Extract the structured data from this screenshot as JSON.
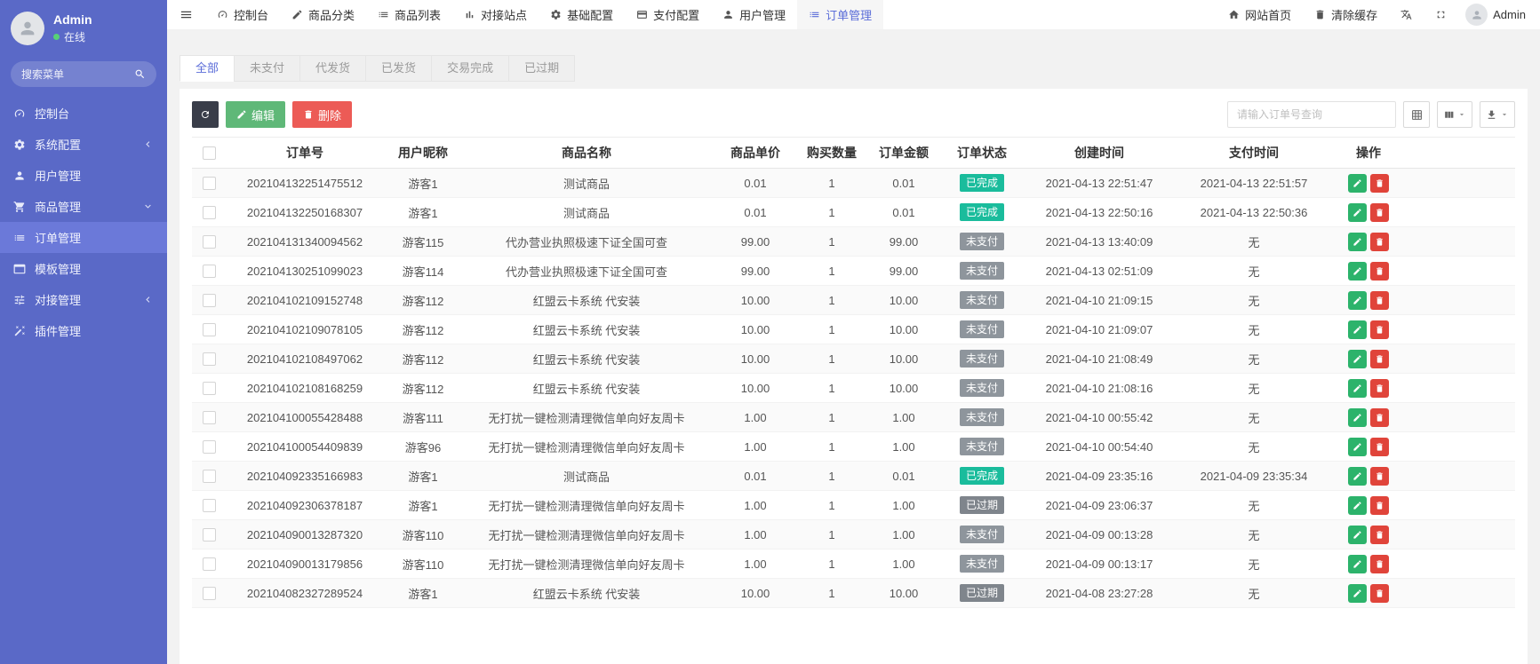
{
  "colors": {
    "sidebar_bg": "#5a69c7",
    "sidebar_active_bg": "#6b79d9",
    "topnav_active_color": "#5a6cd8",
    "online_dot": "#57d176",
    "badge_done": "#1abc9c",
    "badge_unpaid": "#8e959c",
    "badge_expired": "#7f858c",
    "btn_refresh_bg": "#393d49",
    "btn_edit_bg": "#5fb878",
    "btn_delete_bg": "#ec5b56",
    "row_edit_bg": "#2cb36b",
    "row_delete_bg": "#e0443a"
  },
  "sidebar": {
    "user": {
      "name": "Admin",
      "status": "在线"
    },
    "search_placeholder": "搜索菜单",
    "items": [
      {
        "key": "console",
        "label": "控制台",
        "icon": "dashboard-icon",
        "arrow": "",
        "active": false
      },
      {
        "key": "system-config",
        "label": "系统配置",
        "icon": "gear-icon",
        "arrow": "left",
        "active": false
      },
      {
        "key": "user-management",
        "label": "用户管理",
        "icon": "user-icon",
        "arrow": "",
        "active": false
      },
      {
        "key": "product-management",
        "label": "商品管理",
        "icon": "cart-icon",
        "arrow": "down",
        "active": false
      },
      {
        "key": "order-management",
        "label": "订单管理",
        "icon": "list-icon",
        "arrow": "",
        "active": true
      },
      {
        "key": "template-management",
        "label": "模板管理",
        "icon": "window-icon",
        "arrow": "",
        "active": false
      },
      {
        "key": "integration-management",
        "label": "对接管理",
        "icon": "sliders-icon",
        "arrow": "left",
        "active": false
      },
      {
        "key": "plugin-management",
        "label": "插件管理",
        "icon": "wand-icon",
        "arrow": "",
        "active": false
      }
    ]
  },
  "topnav": {
    "items": [
      {
        "key": "console",
        "label": "控制台",
        "icon": "dashboard-icon",
        "active": false
      },
      {
        "key": "product-category",
        "label": "商品分类",
        "icon": "edit-icon",
        "active": false
      },
      {
        "key": "product-list",
        "label": "商品列表",
        "icon": "list-icon",
        "active": false
      },
      {
        "key": "integration-sites",
        "label": "对接站点",
        "icon": "chart-icon",
        "active": false
      },
      {
        "key": "basic-config",
        "label": "基础配置",
        "icon": "gear-icon",
        "active": false
      },
      {
        "key": "payment-config",
        "label": "支付配置",
        "icon": "card-icon",
        "active": false
      },
      {
        "key": "user-management",
        "label": "用户管理",
        "icon": "user-icon",
        "active": false
      },
      {
        "key": "order-management",
        "label": "订单管理",
        "icon": "list-icon",
        "active": true
      }
    ],
    "right_items": [
      {
        "key": "site-home",
        "label": "网站首页",
        "icon": "home-icon"
      },
      {
        "key": "clear-cache",
        "label": "清除缓存",
        "icon": "trash-icon"
      },
      {
        "key": "translate",
        "label": "",
        "icon": "translate-icon"
      },
      {
        "key": "fullscreen",
        "label": "",
        "icon": "fullscreen-icon"
      }
    ],
    "user": {
      "name": "Admin"
    }
  },
  "tabs": [
    {
      "key": "all",
      "label": "全部",
      "active": true
    },
    {
      "key": "unpaid",
      "label": "未支付",
      "active": false
    },
    {
      "key": "to-ship",
      "label": "代发货",
      "active": false
    },
    {
      "key": "shipped",
      "label": "已发货",
      "active": false
    },
    {
      "key": "completed",
      "label": "交易完成",
      "active": false
    },
    {
      "key": "expired",
      "label": "已过期",
      "active": false
    }
  ],
  "toolbar": {
    "edit_label": "编辑",
    "delete_label": "删除",
    "search_placeholder": "请输入订单号查询"
  },
  "table": {
    "columns": [
      "订单号",
      "用户昵称",
      "商品名称",
      "商品单价",
      "购买数量",
      "订单金额",
      "订单状态",
      "创建时间",
      "支付时间",
      "操作"
    ],
    "rows": [
      {
        "order_no": "202104132251475512",
        "nickname": "游客1",
        "product": "测试商品",
        "price": "0.01",
        "quantity": "1",
        "amount": "0.01",
        "status": "已完成",
        "status_type": "done",
        "created": "2021-04-13 22:51:47",
        "paid": "2021-04-13 22:51:57"
      },
      {
        "order_no": "202104132250168307",
        "nickname": "游客1",
        "product": "测试商品",
        "price": "0.01",
        "quantity": "1",
        "amount": "0.01",
        "status": "已完成",
        "status_type": "done",
        "created": "2021-04-13 22:50:16",
        "paid": "2021-04-13 22:50:36"
      },
      {
        "order_no": "202104131340094562",
        "nickname": "游客115",
        "product": "代办营业执照极速下证全国可查",
        "price": "99.00",
        "quantity": "1",
        "amount": "99.00",
        "status": "未支付",
        "status_type": "unpaid",
        "created": "2021-04-13 13:40:09",
        "paid": "无"
      },
      {
        "order_no": "202104130251099023",
        "nickname": "游客114",
        "product": "代办营业执照极速下证全国可查",
        "price": "99.00",
        "quantity": "1",
        "amount": "99.00",
        "status": "未支付",
        "status_type": "unpaid",
        "created": "2021-04-13 02:51:09",
        "paid": "无"
      },
      {
        "order_no": "202104102109152748",
        "nickname": "游客112",
        "product": "红盟云卡系统 代安装",
        "price": "10.00",
        "quantity": "1",
        "amount": "10.00",
        "status": "未支付",
        "status_type": "unpaid",
        "created": "2021-04-10 21:09:15",
        "paid": "无"
      },
      {
        "order_no": "202104102109078105",
        "nickname": "游客112",
        "product": "红盟云卡系统 代安装",
        "price": "10.00",
        "quantity": "1",
        "amount": "10.00",
        "status": "未支付",
        "status_type": "unpaid",
        "created": "2021-04-10 21:09:07",
        "paid": "无"
      },
      {
        "order_no": "202104102108497062",
        "nickname": "游客112",
        "product": "红盟云卡系统 代安装",
        "price": "10.00",
        "quantity": "1",
        "amount": "10.00",
        "status": "未支付",
        "status_type": "unpaid",
        "created": "2021-04-10 21:08:49",
        "paid": "无"
      },
      {
        "order_no": "202104102108168259",
        "nickname": "游客112",
        "product": "红盟云卡系统 代安装",
        "price": "10.00",
        "quantity": "1",
        "amount": "10.00",
        "status": "未支付",
        "status_type": "unpaid",
        "created": "2021-04-10 21:08:16",
        "paid": "无"
      },
      {
        "order_no": "202104100055428488",
        "nickname": "游客111",
        "product": "无打扰一键检测清理微信单向好友周卡",
        "price": "1.00",
        "quantity": "1",
        "amount": "1.00",
        "status": "未支付",
        "status_type": "unpaid",
        "created": "2021-04-10 00:55:42",
        "paid": "无"
      },
      {
        "order_no": "202104100054409839",
        "nickname": "游客96",
        "product": "无打扰一键检测清理微信单向好友周卡",
        "price": "1.00",
        "quantity": "1",
        "amount": "1.00",
        "status": "未支付",
        "status_type": "unpaid",
        "created": "2021-04-10 00:54:40",
        "paid": "无"
      },
      {
        "order_no": "202104092335166983",
        "nickname": "游客1",
        "product": "测试商品",
        "price": "0.01",
        "quantity": "1",
        "amount": "0.01",
        "status": "已完成",
        "status_type": "done",
        "created": "2021-04-09 23:35:16",
        "paid": "2021-04-09 23:35:34"
      },
      {
        "order_no": "202104092306378187",
        "nickname": "游客1",
        "product": "无打扰一键检测清理微信单向好友周卡",
        "price": "1.00",
        "quantity": "1",
        "amount": "1.00",
        "status": "已过期",
        "status_type": "expired",
        "created": "2021-04-09 23:06:37",
        "paid": "无"
      },
      {
        "order_no": "202104090013287320",
        "nickname": "游客110",
        "product": "无打扰一键检测清理微信单向好友周卡",
        "price": "1.00",
        "quantity": "1",
        "amount": "1.00",
        "status": "未支付",
        "status_type": "unpaid",
        "created": "2021-04-09 00:13:28",
        "paid": "无"
      },
      {
        "order_no": "202104090013179856",
        "nickname": "游客110",
        "product": "无打扰一键检测清理微信单向好友周卡",
        "price": "1.00",
        "quantity": "1",
        "amount": "1.00",
        "status": "未支付",
        "status_type": "unpaid",
        "created": "2021-04-09 00:13:17",
        "paid": "无"
      },
      {
        "order_no": "202104082327289524",
        "nickname": "游客1",
        "product": "红盟云卡系统 代安装",
        "price": "10.00",
        "quantity": "1",
        "amount": "10.00",
        "status": "已过期",
        "status_type": "expired",
        "created": "2021-04-08 23:27:28",
        "paid": "无"
      }
    ]
  }
}
